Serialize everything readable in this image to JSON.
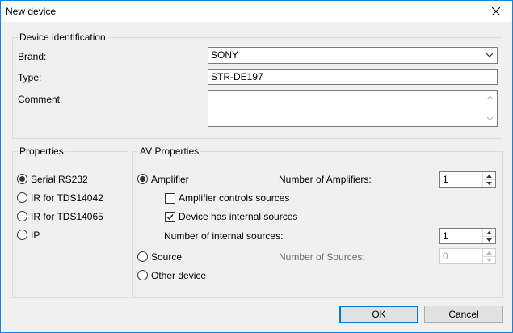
{
  "window": {
    "title": "New device"
  },
  "identification": {
    "legend": "Device identification",
    "brand_label": "Brand:",
    "brand_value": "SONY",
    "type_label": "Type:",
    "type_value": "STR-DE197",
    "comment_label": "Comment:",
    "comment_value": ""
  },
  "properties": {
    "legend": "Properties",
    "options": [
      {
        "label": "Serial RS232",
        "selected": true
      },
      {
        "label": "IR for TDS14042",
        "selected": false
      },
      {
        "label": "IR for TDS14065",
        "selected": false
      },
      {
        "label": "IP",
        "selected": false
      }
    ]
  },
  "av": {
    "legend": "AV Properties",
    "amplifier_label": "Amplifier",
    "num_amplifiers_label": "Number of Amplifiers:",
    "num_amplifiers_value": "1",
    "amp_controls_label": "Amplifier controls sources",
    "amp_controls_checked": false,
    "internal_sources_label": "Device has internal sources",
    "internal_sources_checked": true,
    "num_internal_label": "Number of internal sources:",
    "num_internal_value": "1",
    "source_label": "Source",
    "num_sources_label": "Number of Sources:",
    "num_sources_value": "0",
    "other_label": "Other device"
  },
  "buttons": {
    "ok": "OK",
    "cancel": "Cancel"
  }
}
